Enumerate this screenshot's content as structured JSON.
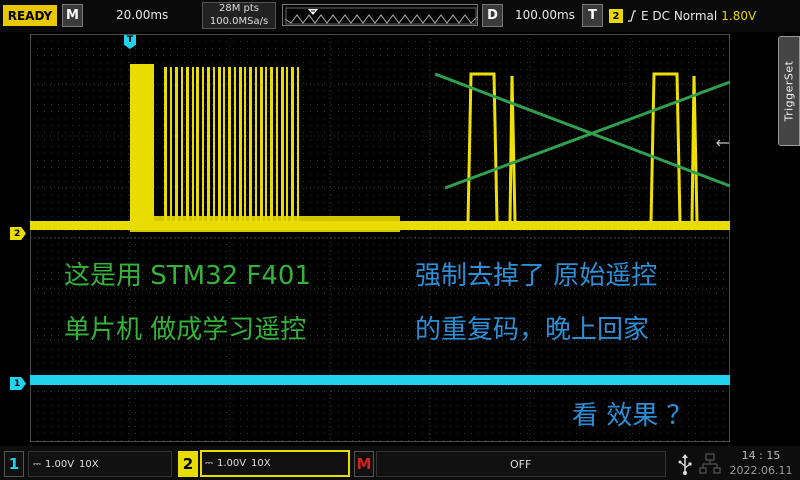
{
  "top_bar": {
    "status": "READY",
    "timebase_key": "M",
    "timebase": "20.00ms",
    "memory_depth": "28M pts",
    "sample_rate": "100.0MSa/s",
    "delay_key": "D",
    "delay": "100.00ms",
    "trigger_key": "T",
    "trigger_source": "2",
    "trigger_mode": "E DC Normal",
    "trigger_level": "1.80V"
  },
  "markers": {
    "trigger_marker": "T",
    "ch2_marker": "2",
    "ch1_marker": "1"
  },
  "side_tab": {
    "label": "TriggerSet"
  },
  "overlay_text": {
    "left_line1": "这是用 STM32 F401",
    "left_line2": "单片机 做成学习遥控",
    "right_line1": "强制去掉了 原始遥控",
    "right_line2": "的重复码，晚上回家",
    "bottom_line": "看 效果 ？"
  },
  "bottom_bar": {
    "ch1": {
      "number": "1",
      "scale": "1.00V",
      "probe": "10X"
    },
    "ch2": {
      "number": "2",
      "scale": "1.00V",
      "probe": "10X"
    },
    "math_key": "M",
    "math_state": "OFF",
    "time": "14 : 15",
    "date": "2022.06.11"
  },
  "colors": {
    "ch1": "#22d3ee",
    "ch2": "#f0e000",
    "status": "#e8c800",
    "annotation_green": "#33b33a",
    "annotation_blue": "#2c8fd6",
    "math": "#d92020"
  },
  "icons": [
    "trigger-edge-rising-icon",
    "usb-icon",
    "network-icon",
    "trigger-level-arrow-icon"
  ]
}
